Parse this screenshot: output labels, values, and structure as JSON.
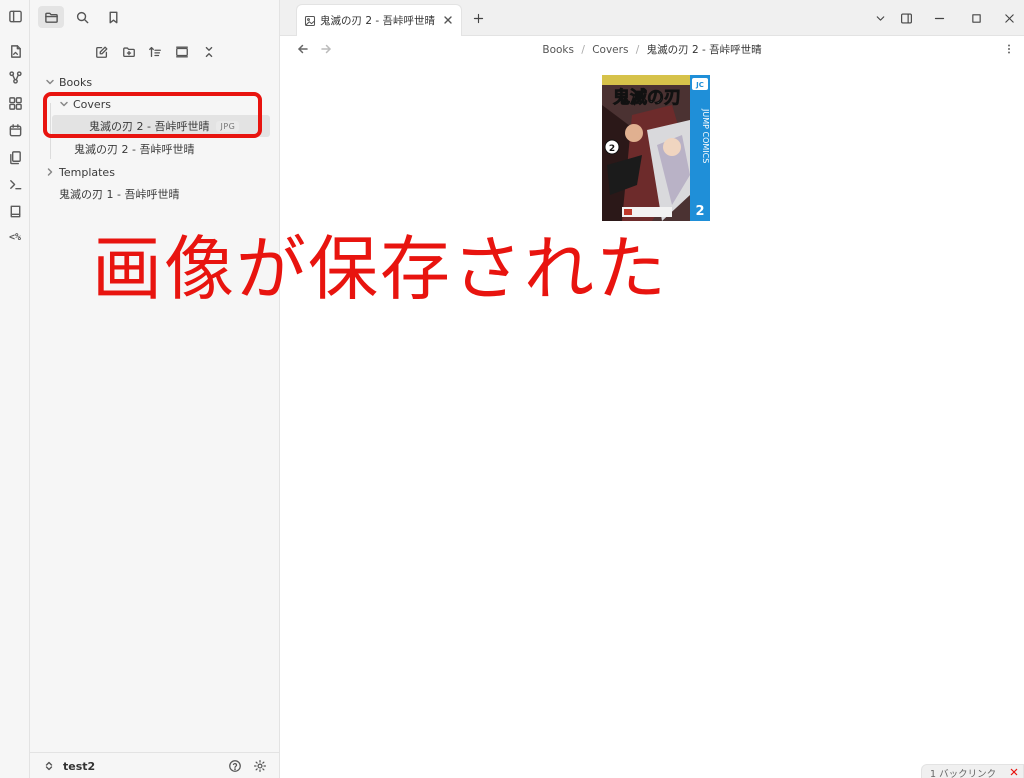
{
  "ribbon": {
    "icons": [
      "open-quick-switcher-icon",
      "graph-view-icon",
      "canvas-icon",
      "daily-note-icon",
      "templates-icon",
      "command-palette-icon",
      "bookmarks-book-icon",
      "code-tag-icon"
    ],
    "code_tag_text": "<%"
  },
  "sidebar": {
    "tabs": [
      "files-tab",
      "search-tab",
      "bookmarks-tab"
    ],
    "tree": {
      "books": "Books",
      "covers": "Covers",
      "cover_file": "鬼滅の刃 2 - 吾峠呼世晴",
      "cover_file_ext": "JPG",
      "book2_note": "鬼滅の刃 2 - 吾峠呼世晴",
      "templates": "Templates",
      "book1_note": "鬼滅の刃 1 - 吾峠呼世晴"
    },
    "vault_name": "test2"
  },
  "tabbar": {
    "active_tab_title": "鬼滅の刃 2 - 吾峠呼世晴"
  },
  "view_header": {
    "breadcrumb": [
      "Books",
      "Covers",
      "鬼滅の刃 2 - 吾峠呼世晴"
    ],
    "separator": "/"
  },
  "cover_image": {
    "logo_text": "鬼滅の刃",
    "series_label": "JUMP COMICS",
    "volume": "2",
    "publisher_badge": "JC"
  },
  "annotation": {
    "caption": "画像が保存された",
    "color": "#e8140f"
  },
  "status_bar": {
    "backlinks": "1 バックリンク"
  },
  "colors": {
    "accent_red": "#e8140f",
    "sidebar_bg": "#f6f6f6",
    "cover_blue": "#1f8fd8"
  }
}
